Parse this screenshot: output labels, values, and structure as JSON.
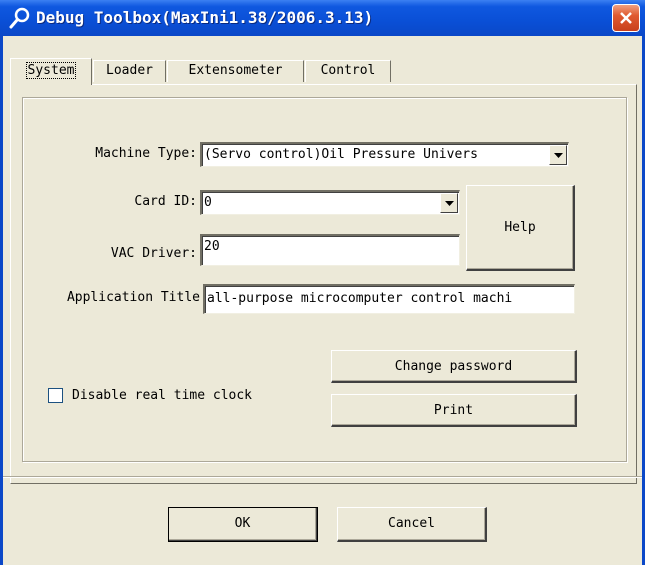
{
  "window": {
    "title": "Debug Toolbox(MaxIni1.38/2006.3.13)"
  },
  "tabs": [
    {
      "label": "System",
      "active": true
    },
    {
      "label": "Loader",
      "active": false
    },
    {
      "label": "Extensometer",
      "active": false
    },
    {
      "label": "Control",
      "active": false
    }
  ],
  "form": {
    "machine_type_label": "Machine Type:",
    "machine_type_value": "(Servo control)Oil Pressure Univers",
    "card_id_label": "Card ID:",
    "card_id_value": "0",
    "vac_driver_label": "VAC Driver:",
    "vac_driver_value": "20",
    "app_title_label": "Application Title",
    "app_title_value": "all-purpose microcomputer control machi",
    "help_label": "Help",
    "change_password_label": "Change password",
    "print_label": "Print",
    "disable_clock_label": "Disable real time clock",
    "disable_clock_checked": false
  },
  "footer": {
    "ok_label": "OK",
    "cancel_label": "Cancel"
  },
  "colors": {
    "titlebar": "#0b48c8",
    "dialog_bg": "#ece9d8",
    "close_button": "#e05a30"
  },
  "icons": {
    "title_icon": "magnifier-icon",
    "close_icon": "close-icon",
    "dropdown_icon": "chevron-down-icon"
  }
}
